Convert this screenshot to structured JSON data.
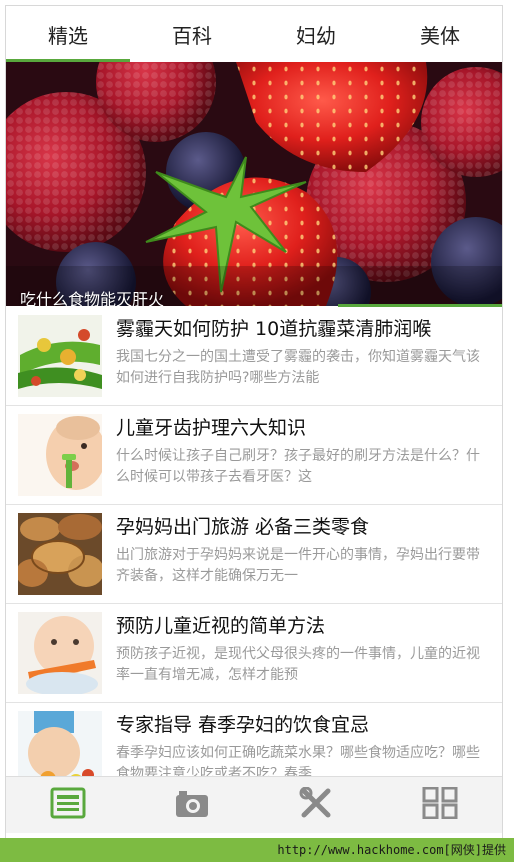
{
  "tabs": [
    {
      "label": "精选",
      "active": true
    },
    {
      "label": "百科",
      "active": false
    },
    {
      "label": "妇幼",
      "active": false
    },
    {
      "label": "美体",
      "active": false
    }
  ],
  "banner": {
    "caption": "吃什么食物能灭肝火"
  },
  "articles": [
    {
      "title": "雾霾天如何防护 10道抗霾菜清肺润喉",
      "desc": "我国七分之一的国土遭受了雾霾的袭击，你知道雾霾天气该如何进行自我防护吗?哪些方法能"
    },
    {
      "title": "儿童牙齿护理六大知识",
      "desc": "什么时候让孩子自己刷牙？孩子最好的刷牙方法是什么？什么时候可以带孩子去看牙医？这"
    },
    {
      "title": "孕妈妈出门旅游 必备三类零食",
      "desc": "出门旅游对于孕妈妈来说是一件开心的事情，孕妈出行要带齐装备，这样才能确保万无一"
    },
    {
      "title": "预防儿童近视的简单方法",
      "desc": "预防孩子近视，是现代父母很头疼的一件事情，儿童的近视率一直有增无减，怎样才能预"
    },
    {
      "title": "专家指导 春季孕妇的饮食宜忌",
      "desc": "春季孕妇应该如何正确吃蔬菜水果？哪些食物适应吃？哪些食物要注意少吃或者不吃？春季"
    }
  ],
  "bottom_nav": [
    {
      "icon": "news-icon",
      "active": true
    },
    {
      "icon": "camera-icon",
      "active": false
    },
    {
      "icon": "tools-icon",
      "active": false
    },
    {
      "icon": "grid-icon",
      "active": false
    }
  ],
  "footer": {
    "watermark": "http://www.hackhome.com[网侠]提供"
  },
  "colors": {
    "accent": "#59a83d",
    "footer": "#7dbb42"
  }
}
